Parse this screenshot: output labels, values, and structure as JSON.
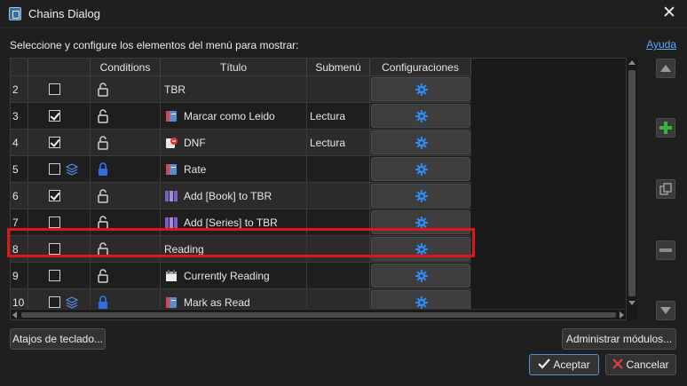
{
  "window": {
    "title": "Chains Dialog",
    "close_glyph": "✕"
  },
  "instructions": "Seleccione y configure los elementos del menú para mostrar:",
  "help_link": "Ayuda",
  "table": {
    "headers": {
      "conditions": "Conditions",
      "title": "Título",
      "submenu": "Submenú",
      "config": "Configuraciones"
    },
    "rows": [
      {
        "num": "2",
        "checked": false,
        "layers": false,
        "lock": "open",
        "icon": "",
        "title": "TBR",
        "submenu": ""
      },
      {
        "num": "3",
        "checked": true,
        "layers": false,
        "lock": "open",
        "icon": "book-icon",
        "title": "Marcar como Leido",
        "submenu": "Lectura"
      },
      {
        "num": "4",
        "checked": true,
        "layers": false,
        "lock": "open",
        "icon": "dnf-icon",
        "title": "DNF",
        "submenu": "Lectura"
      },
      {
        "num": "5",
        "checked": false,
        "layers": true,
        "lock": "closed",
        "icon": "book-icon",
        "title": "Rate",
        "submenu": ""
      },
      {
        "num": "6",
        "checked": true,
        "layers": false,
        "lock": "open",
        "icon": "library-icon",
        "title": "Add [Book] to TBR",
        "submenu": ""
      },
      {
        "num": "7",
        "checked": false,
        "layers": false,
        "lock": "open",
        "icon": "library-icon",
        "title": "Add [Series] to TBR",
        "submenu": ""
      },
      {
        "num": "8",
        "checked": false,
        "layers": false,
        "lock": "open",
        "icon": "",
        "title": "Reading",
        "submenu": ""
      },
      {
        "num": "9",
        "checked": false,
        "layers": false,
        "lock": "open",
        "icon": "calendar-icon",
        "title": "Currently Reading",
        "submenu": ""
      },
      {
        "num": "10",
        "checked": false,
        "layers": true,
        "lock": "closed",
        "icon": "book-icon",
        "title": "Mark as Read",
        "submenu": ""
      }
    ]
  },
  "side_buttons": [
    "move-up",
    "add",
    "copy",
    "remove",
    "move-down"
  ],
  "buttons": {
    "shortcuts": "Atajos de teclado...",
    "manage_modules": "Administrar módulos...",
    "accept": "Aceptar",
    "cancel": "Cancelar"
  },
  "colors": {
    "highlight": "#e0151b",
    "gear": "#2f8cf0",
    "add": "#3fb03f",
    "lock_closed": "#2f6fe0"
  }
}
